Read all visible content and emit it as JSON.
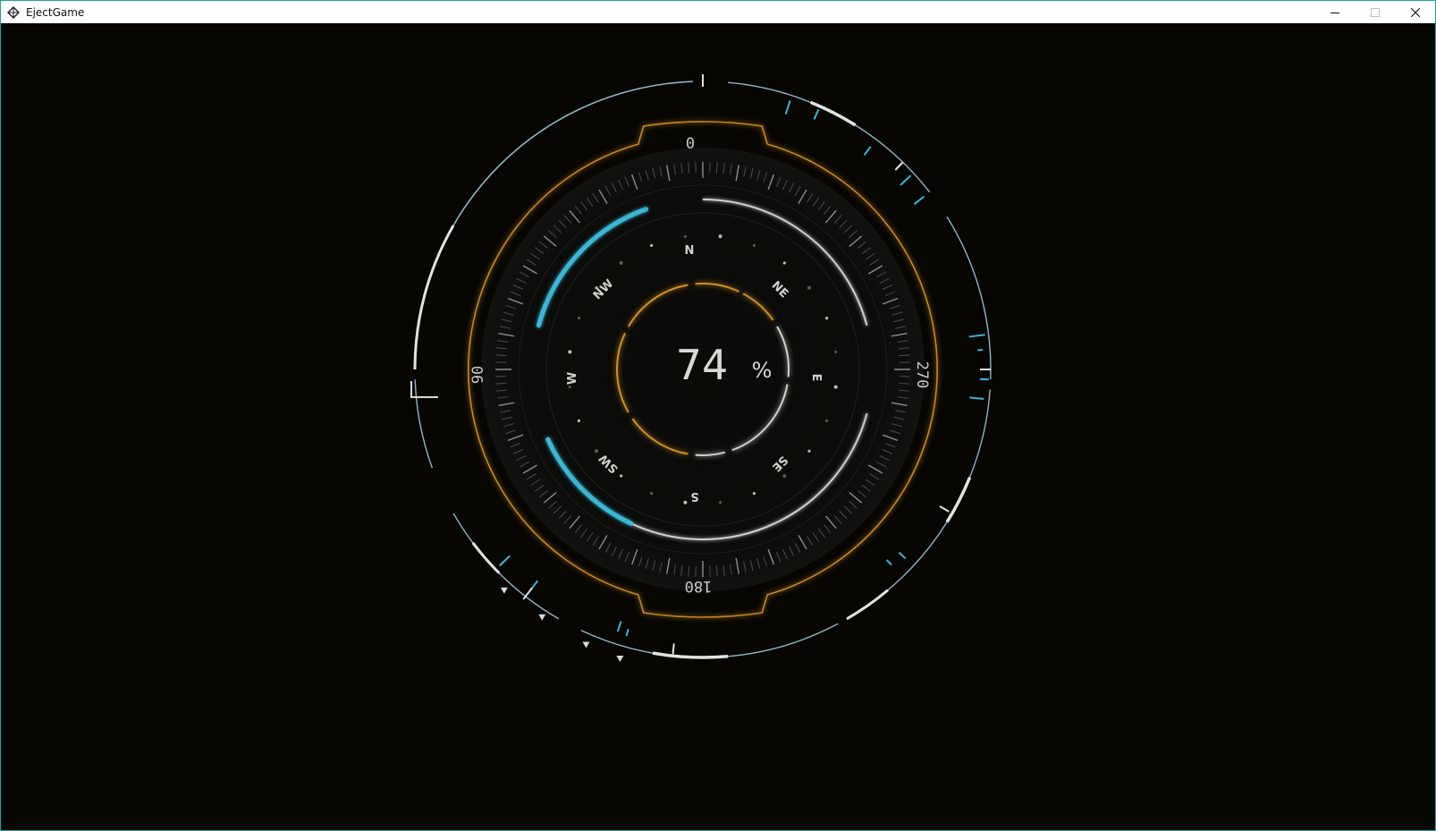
{
  "window": {
    "title": "EjectGame",
    "app_icon": "unity-logo-icon",
    "controls": [
      "minimize-icon",
      "maximize-icon",
      "close-icon"
    ]
  },
  "hud": {
    "value": "74",
    "unit": "%",
    "level_fraction": 0.74,
    "heading_labels": {
      "north": "0",
      "east": "270",
      "south": "180",
      "west": "90"
    },
    "compass_points": {
      "n": "N",
      "ne": "NE",
      "e": "E",
      "se": "SE",
      "s": "S",
      "sw": "SW",
      "w": "W",
      "nw": "NW"
    },
    "colors": {
      "background": "#070603",
      "orange": "#d08f22",
      "cyan": "#3bb6d4",
      "white": "#d8d8d5",
      "frame": "#1aa3a8"
    }
  }
}
